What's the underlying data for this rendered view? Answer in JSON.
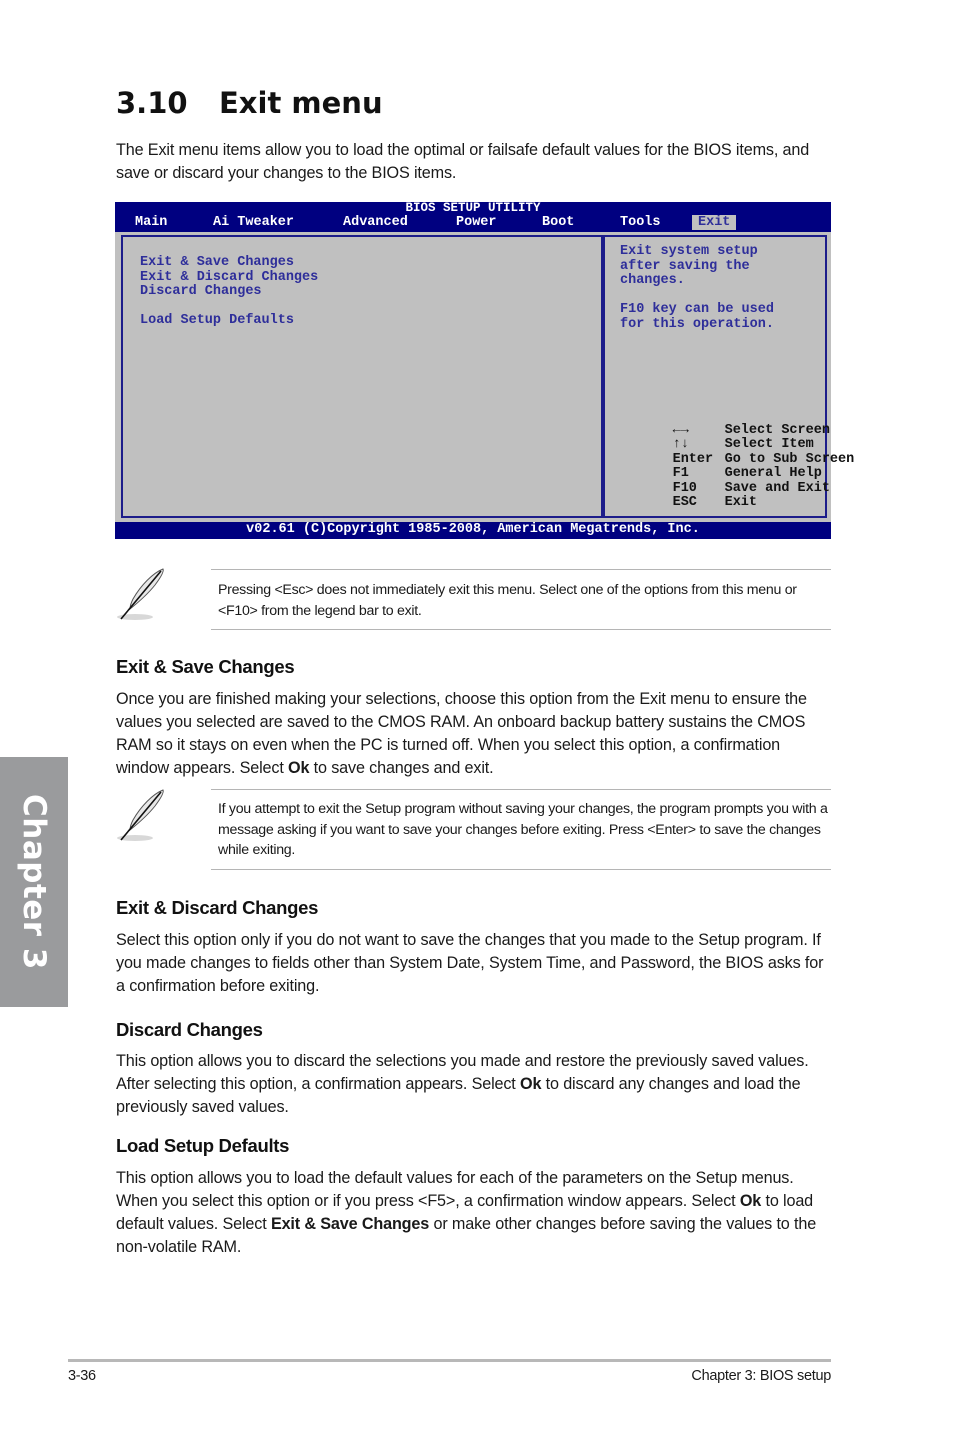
{
  "chapter_tab": {
    "label": "Chapter 3"
  },
  "section": {
    "number": "3.10",
    "title": "Exit menu",
    "intro": "The Exit menu items allow you to load the optimal or failsafe default values for the BIOS items, and save or discard your changes to the BIOS items."
  },
  "bios": {
    "title": "BIOS SETUP UTILITY",
    "tabs": [
      {
        "label": "Main"
      },
      {
        "label": "Ai Tweaker"
      },
      {
        "label": "Advanced"
      },
      {
        "label": "Power"
      },
      {
        "label": "Boot"
      },
      {
        "label": "Tools"
      },
      {
        "label": "Exit",
        "active": true
      }
    ],
    "menu_items": [
      {
        "label": "Exit & Save Changes"
      },
      {
        "label": "Exit & Discard Changes"
      },
      {
        "label": "Discard Changes"
      },
      {
        "label": "Load Setup Defaults"
      }
    ],
    "help_lines": [
      "Exit system setup",
      "after saving the",
      "changes.",
      "",
      "F10 key can be used",
      "for this operation."
    ],
    "legend": [
      {
        "key": "left-right-arrows",
        "icon": "←→",
        "action": "Select Screen"
      },
      {
        "key": "up-down-arrows",
        "icon": "↑↓",
        "action": "Select Item"
      },
      {
        "key": "Enter",
        "action": "Go to Sub Screen"
      },
      {
        "key": "F1",
        "action": "General Help"
      },
      {
        "key": "F10",
        "action": "Save and Exit"
      },
      {
        "key": "ESC",
        "action": "Exit"
      }
    ],
    "footer": "v02.61 (C)Copyright 1985-2008, American Megatrends, Inc.",
    "colors": {
      "header_bg": "#000080",
      "panel_bg": "#c0c0c0",
      "text": "#2e2e9a"
    }
  },
  "notes": [
    {
      "icon": "feather-pen-icon",
      "text": "Pressing <Esc> does not immediately exit this menu. Select one of the options from this menu or <F10> from the legend bar to exit."
    },
    {
      "icon": "feather-pen-icon",
      "text": "If you attempt to exit the Setup program without saving your changes, the program prompts you with a message asking if you want to save your changes before exiting. Press <Enter> to save the changes while exiting."
    }
  ],
  "subsections": [
    {
      "heading": "Exit & Save Changes",
      "text_parts": [
        "Once you are finished making your selections, choose this option from the Exit menu to ensure the values you selected are saved to the CMOS RAM. An onboard backup battery sustains the CMOS RAM so it stays on even when the PC is turned off. When you select this option, a confirmation window appears. Select ",
        "Ok",
        " to save changes and exit."
      ]
    },
    {
      "heading": "Exit & Discard Changes",
      "text_parts": [
        "Select this option only if you do not want to save the changes that you  made to the Setup program. If you made changes to fields other than System Date, System Time, and Password, the BIOS asks for a confirmation before exiting."
      ]
    },
    {
      "heading": "Discard Changes",
      "text_parts": [
        "This option allows you to discard the selections you made and restore the previously saved values. After selecting this option, a confirmation appears. Select ",
        "Ok",
        " to discard any changes and load the previously saved values."
      ]
    },
    {
      "heading": "Load Setup Defaults",
      "text_parts": [
        "This option allows you to load the default values for each of the parameters on the Setup menus. When you select this option or if you press <F5>, a confirmation window appears. Select ",
        "Ok",
        " to load default values. Select ",
        "Exit & Save Changes",
        " or make other changes before saving the values to the non-volatile RAM."
      ]
    }
  ],
  "footer": {
    "page_number": "3-36",
    "chapter_label": "Chapter 3: BIOS setup"
  }
}
